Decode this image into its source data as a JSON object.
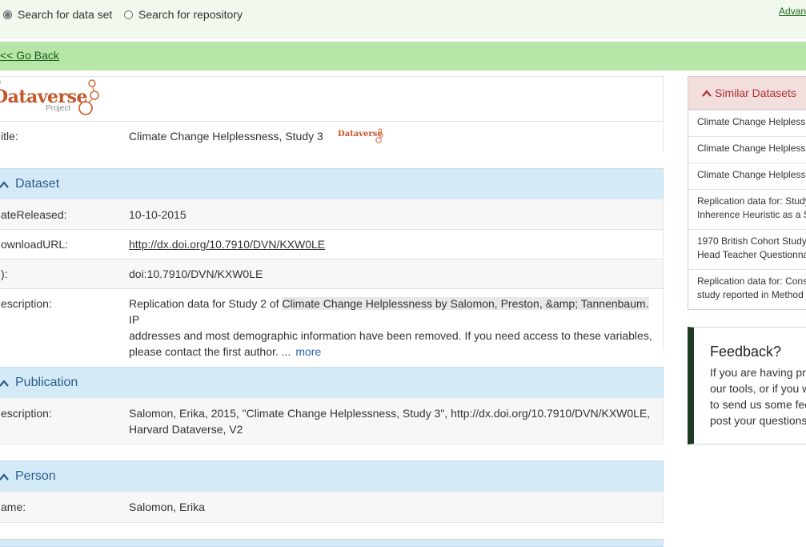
{
  "topbar": {
    "radio_dataset": "Search for data set",
    "radio_repository": "Search for repository",
    "advanced": "Advan"
  },
  "nav": {
    "go_back": "<< Go Back"
  },
  "logo": {
    "prefix": "e",
    "name": "Dataverse",
    "sub": "Project"
  },
  "title_row": {
    "label": "itle:",
    "value": "Climate Change Helplessness, Study 3",
    "badge": "Dataverse"
  },
  "dataset": {
    "heading": "Dataset",
    "date_label": "ateReleased:",
    "date_value": "10-10-2015",
    "url_label": "ownloadURL:",
    "url_value": "http://dx.doi.org/10.7910/DVN/KXW0LE",
    "id_label": "):",
    "id_value": "doi:10.7910/DVN/KXW0LE",
    "desc_label": "escription:",
    "desc_pre": "Replication data for Study 2 of ",
    "desc_highlight": "Climate Change Helplessness by Salomon, Preston, &amp; Tannenbaum.",
    "desc_post1": " IP",
    "desc_line2": "addresses and most demographic information have been removed. If you need access to these variables,",
    "desc_line3": "please contact the first author. ...",
    "more": "more"
  },
  "publication": {
    "heading": "Publication",
    "desc_label": "escription:",
    "line1": "Salomon, Erika, 2015, \"Climate Change Helplessness, Study 3\", http://dx.doi.org/10.7910/DVN/KXW0LE,",
    "line2": "Harvard Dataverse, V2"
  },
  "person": {
    "heading": "Person",
    "name_label": "ame:",
    "name_value": "Salomon, Erika"
  },
  "similar": {
    "heading": "Similar Datasets",
    "items": [
      [
        "Climate Change Helplessness"
      ],
      [
        "Climate Change Helplessness"
      ],
      [
        "Climate Change Helplessness"
      ],
      [
        "Replication data for: Study",
        "Inherence Heuristic as a S"
      ],
      [
        "1970 British Cohort Study",
        "Head Teacher Questionna"
      ],
      [
        "Replication data for: Cons",
        "study reported in Method"
      ]
    ]
  },
  "feedback": {
    "heading": "Feedback?",
    "lines": [
      "If you are having pro",
      "our tools, or if you w",
      "to send us some fee",
      "post your questions"
    ]
  },
  "colors": {
    "accent_green": "#b6e6a8",
    "section_blue": "#d5eaf7",
    "similar_red": "#b03030"
  }
}
